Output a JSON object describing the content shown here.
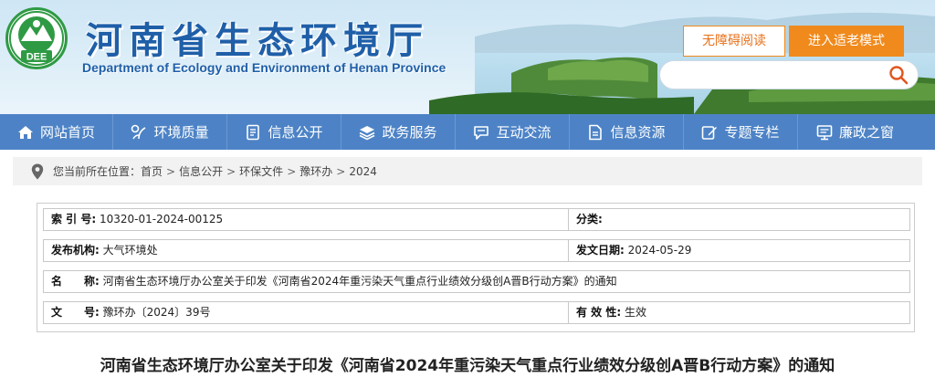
{
  "header": {
    "title_cn": "河南省生态环境厅",
    "title_en": "Department of Ecology and Environment of Henan Province",
    "logo_text": "DEE",
    "accessibility_label": "无障碍阅读",
    "elder_mode_label": "进入适老模式",
    "search_placeholder": ""
  },
  "nav": {
    "items": [
      {
        "label": "网站首页",
        "icon": "home-icon"
      },
      {
        "label": "环境质量",
        "icon": "environment-icon"
      },
      {
        "label": "信息公开",
        "icon": "document-icon"
      },
      {
        "label": "政务服务",
        "icon": "layers-icon"
      },
      {
        "label": "互动交流",
        "icon": "chat-icon"
      },
      {
        "label": "信息资源",
        "icon": "file-icon"
      },
      {
        "label": "专题专栏",
        "icon": "edit-icon"
      },
      {
        "label": "廉政之窗",
        "icon": "monitor-icon"
      }
    ]
  },
  "breadcrumb": {
    "prefix": "您当前所在位置：",
    "items": [
      "首页",
      "信息公开",
      "环保文件",
      "豫环办",
      "2024"
    ],
    "separator": ">"
  },
  "info": {
    "index_label": "索 引 号:",
    "index_value": "10320-01-2024-00125",
    "category_label": "分类:",
    "category_value": "",
    "issuer_label": "发布机构:",
    "issuer_value": "大气环境处",
    "date_label": "发文日期:",
    "date_value": "2024-05-29",
    "name_label": "名　　称:",
    "name_value": "河南省生态环境厅办公室关于印发《河南省2024年重污染天气重点行业绩效分级创A晋B行动方案》的通知",
    "docno_label": "文　　号:",
    "docno_value": "豫环办〔2024〕39号",
    "validity_label": "有 效 性:",
    "validity_value": "生效"
  },
  "article": {
    "title": "河南省生态环境厅办公室关于印发《河南省2024年重污染天气重点行业绩效分级创A晋B行动方案》的通知"
  },
  "colors": {
    "nav_bg": "#4d83c6",
    "brand_blue": "#1f5fa8",
    "accent_orange": "#f08a1c",
    "logo_green": "#2f9a44"
  }
}
